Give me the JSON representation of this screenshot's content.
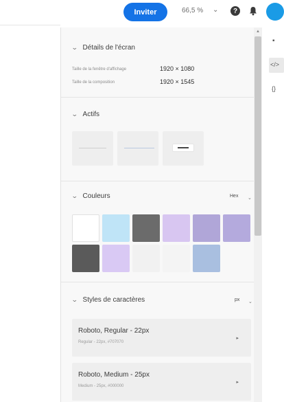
{
  "topbar": {
    "invite_label": "Inviter",
    "zoom_value": "66,5 %",
    "zoom_caret": "⌄",
    "help_glyph": "?"
  },
  "panel": {
    "screen_details": {
      "title": "Détails de l'écran",
      "rows": [
        {
          "label": "Taille de la fenêtre d'affichage",
          "value": "1920 × 1080"
        },
        {
          "label": "Taille de la composition",
          "value": "1920 × 1545"
        }
      ]
    },
    "assets": {
      "title": "Actifs"
    },
    "colors": {
      "title": "Couleurs",
      "manage_label": "Hex",
      "swatches": [
        "#ffffff",
        "#bfe4f7",
        "#6b6b6b",
        "#d8c6f1",
        "#b0a6d8",
        "#b4aadd",
        "#5a5a5a",
        "#d9c9f4",
        "#f1f1f1",
        "#f4f4f4",
        "#a9bfe0"
      ]
    },
    "char_styles": {
      "title": "Styles de caractères",
      "manage_label": "px",
      "items": [
        {
          "title": "Roboto, Regular - 22px",
          "sub": "Regular - 22px, #707070"
        },
        {
          "title": "Roboto, Medium - 25px",
          "sub": "Medium - 25px, #000000"
        }
      ]
    }
  },
  "rail": {
    "comment_icon": "▪",
    "code_icon": "</>",
    "braces_icon": "{}"
  }
}
